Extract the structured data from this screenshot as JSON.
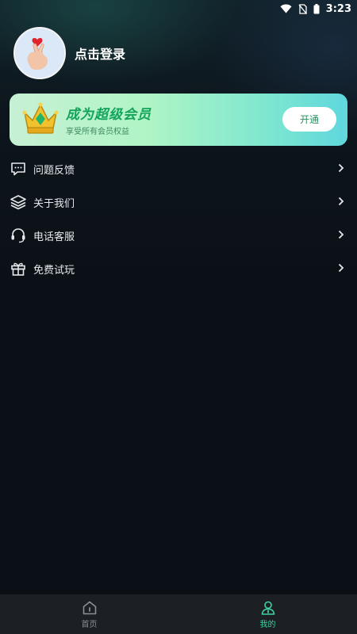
{
  "status_bar": {
    "time": "3:23"
  },
  "profile": {
    "login_text": "点击登录"
  },
  "vip": {
    "title": "成为超级会员",
    "subtitle": "享受所有会员权益",
    "button_label": "开通"
  },
  "menu": {
    "items": [
      {
        "label": "问题反馈",
        "icon": "feedback-icon"
      },
      {
        "label": "关于我们",
        "icon": "layers-icon"
      },
      {
        "label": "电话客服",
        "icon": "headset-icon"
      },
      {
        "label": "免费试玩",
        "icon": "gift-icon"
      }
    ]
  },
  "bottom_nav": {
    "tabs": [
      {
        "label": "首页",
        "icon": "home-icon"
      },
      {
        "label": "我的",
        "icon": "profile-icon",
        "active": true
      }
    ]
  },
  "colors": {
    "accent": "#3fd1a0",
    "vip_title": "#14a35b",
    "background": "#0b1016"
  }
}
